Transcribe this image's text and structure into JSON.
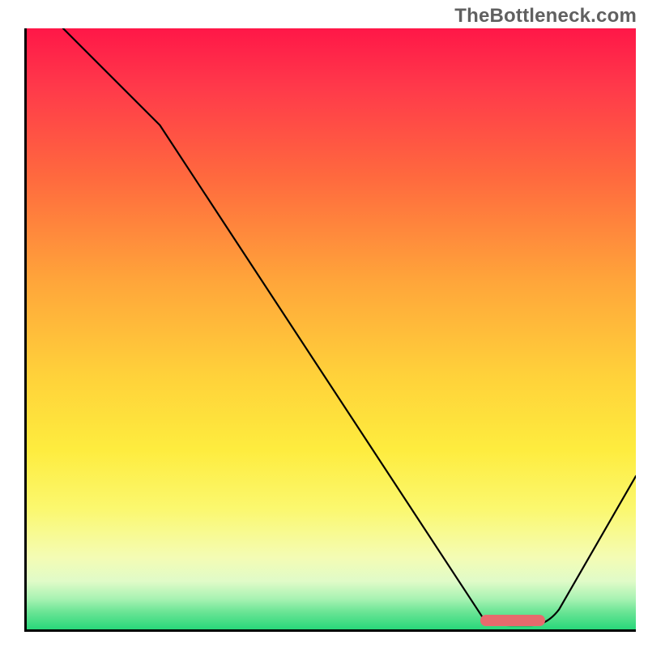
{
  "watermark": "TheBottleneck.com",
  "colors": {
    "axis": "#000000",
    "gradient_top": "#ff1748",
    "gradient_bottom": "#28d77a",
    "curve": "#000000",
    "marker": "#e76a6d"
  },
  "chart_data": {
    "type": "line",
    "title": "",
    "xlabel": "",
    "ylabel": "",
    "xlim": [
      0,
      100
    ],
    "ylim": [
      0,
      100
    ],
    "x": [
      0,
      5,
      20,
      75,
      83,
      100
    ],
    "values": [
      120,
      100,
      82,
      0,
      0,
      25
    ],
    "background_gradient": "bottleneck-severity",
    "marker": {
      "x_center": 79,
      "width": 10,
      "y": 1.2
    }
  }
}
